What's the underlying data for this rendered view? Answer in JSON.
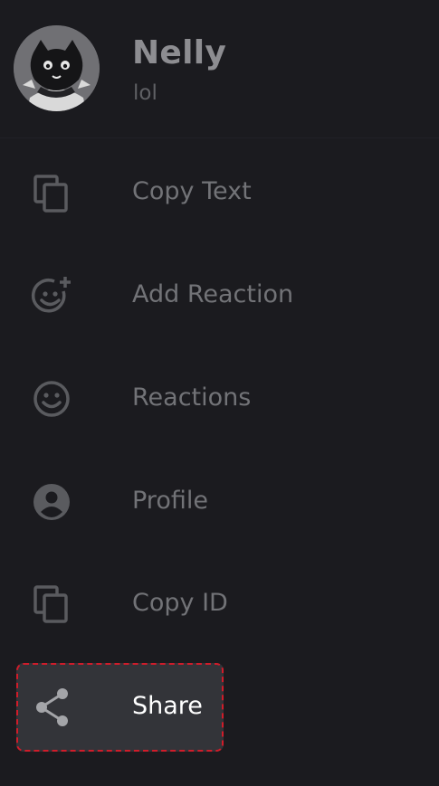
{
  "user": {
    "name": "Nelly",
    "status": "lol",
    "avatar_icon": "cat-avatar"
  },
  "menu": {
    "items": [
      {
        "label": "Copy Text",
        "icon": "copy-icon"
      },
      {
        "label": "Add Reaction",
        "icon": "add-reaction-icon"
      },
      {
        "label": "Reactions",
        "icon": "emoji-icon"
      },
      {
        "label": "Profile",
        "icon": "profile-icon"
      },
      {
        "label": "Copy ID",
        "icon": "copy-icon"
      },
      {
        "label": "Share",
        "icon": "share-icon"
      }
    ]
  },
  "colors": {
    "background": "#1b1b1f",
    "muted_text": "#727377",
    "highlight_bg": "#333439",
    "highlight_border": "#d01c2a"
  }
}
